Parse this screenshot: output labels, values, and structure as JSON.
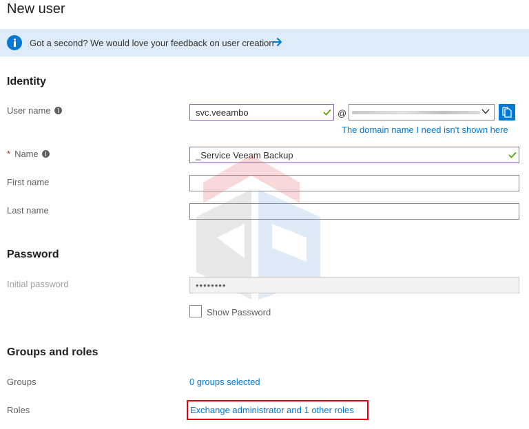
{
  "page": {
    "title": "New user"
  },
  "banner": {
    "text": "Got a second? We would love your feedback on user creation"
  },
  "identity": {
    "heading": "Identity",
    "username": {
      "label": "User name",
      "value": "svc.veeambo",
      "at": "@",
      "domain_link": "The domain name I need isn't shown here"
    },
    "name": {
      "required_mark": "*",
      "label": "Name",
      "value": "_Service Veeam Backup"
    },
    "first_name": {
      "label": "First name",
      "value": ""
    },
    "last_name": {
      "label": "Last name",
      "value": ""
    }
  },
  "password": {
    "heading": "Password",
    "initial": {
      "label": "Initial password",
      "value": "••••••••"
    },
    "show_label": "Show Password"
  },
  "groups_roles": {
    "heading": "Groups and roles",
    "groups": {
      "label": "Groups",
      "value": "0 groups selected"
    },
    "roles": {
      "label": "Roles",
      "value": "Exchange administrator and 1 other roles"
    }
  },
  "colors": {
    "accent": "#0078d4",
    "valid_border": "#8764b8",
    "valid_check": "#57a300",
    "banner_bg": "#deecf9",
    "highlight": "#e3000f"
  },
  "icons": {
    "banner": "info-circle-icon",
    "arrow": "arrow-right-icon",
    "field_info": "info-icon",
    "valid": "checkmark-icon",
    "dropdown": "chevron-down-icon",
    "copy": "copy-icon"
  }
}
